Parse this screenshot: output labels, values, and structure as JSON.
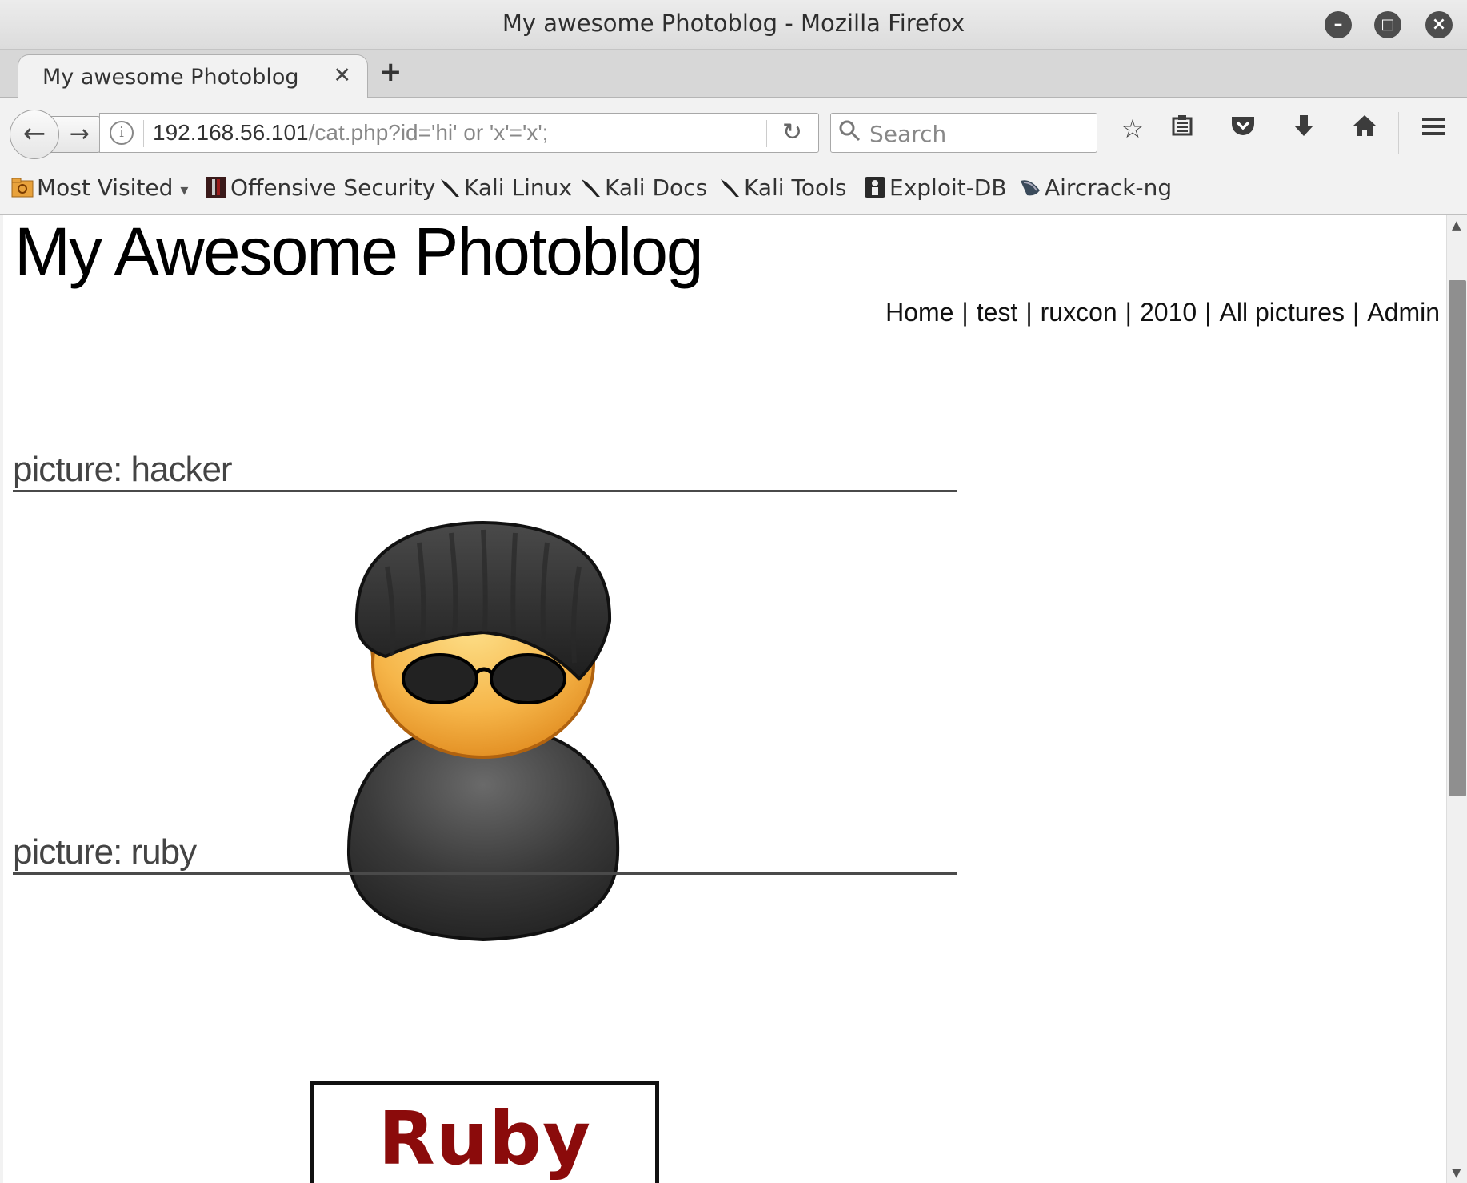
{
  "window": {
    "title": "My awesome Photoblog - Mozilla Firefox"
  },
  "tab": {
    "label": "My awesome Photoblog"
  },
  "urlbar": {
    "host": "192.168.56.101",
    "path": "/cat.php?id='hi' or 'x'='x';"
  },
  "search": {
    "placeholder": "Search"
  },
  "bookmarks": [
    "Most Visited",
    "Offensive Security",
    "Kali Linux",
    "Kali Docs",
    "Kali Tools",
    "Exploit-DB",
    "Aircrack-ng"
  ],
  "page": {
    "heading": "My Awesome Photoblog",
    "nav": [
      "Home",
      "test",
      "ruxcon",
      "2010",
      "All pictures",
      "Admin"
    ],
    "nav_sep": "|",
    "pictures": [
      {
        "title": "picture: hacker"
      },
      {
        "title": "picture: ruby",
        "image_text": "Ruby"
      }
    ]
  },
  "icons": [
    "back-icon",
    "forward-icon",
    "info-icon",
    "reload-icon",
    "search-icon",
    "bookmark-star-icon",
    "reader-list-icon",
    "pocket-icon",
    "download-icon",
    "home-icon",
    "menu-icon"
  ],
  "colors": {
    "ruby_text": "#8b0b0b",
    "heading": "#000000"
  }
}
